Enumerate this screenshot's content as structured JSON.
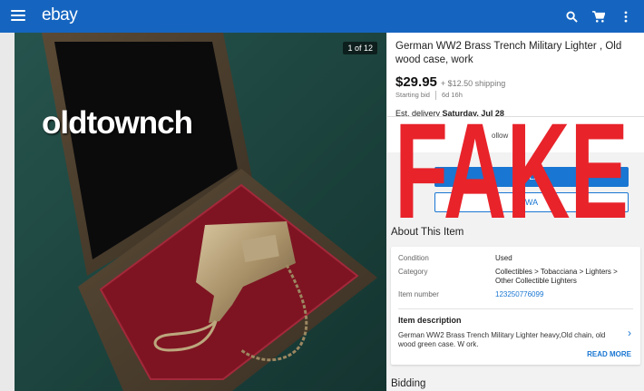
{
  "header": {
    "logo": "ebay",
    "menu_icon": "hamburger-menu-icon",
    "search_icon": "search-icon",
    "cart_icon": "cart-icon",
    "more_icon": "more-vert-icon",
    "brand_color": "#1565c0"
  },
  "gallery": {
    "counter": "1 of 12",
    "watermark": "oldtownch"
  },
  "listing": {
    "title": "German WW2 Brass Trench Military Lighter , Old wood case, work",
    "price": "$29.95",
    "shipping": "+ $12.50 shipping",
    "starting_bid_label": "Starting bid",
    "time_left": "6d 16h",
    "delivery_label": "Est. delivery",
    "delivery_date": "Saturday, Jul 28",
    "follow_label": "ollow",
    "bid_button": "PLA",
    "watch_button": "WA"
  },
  "overlay": {
    "text": "FAKE",
    "color": "#e8232a"
  },
  "about": {
    "heading": "About This Item",
    "specs": [
      {
        "key": "Condition",
        "value": "Used"
      },
      {
        "key": "Category",
        "value": "Collectibles > Tobacciana > Lighters > Other Collectible Lighters"
      },
      {
        "key": "Item number",
        "value": "123250776099"
      }
    ],
    "description_heading": "Item description",
    "description": "German WW2 Brass Trench Military Lighter heavy,Old chain, old wood green case. W ork.",
    "read_more": "READ MORE"
  },
  "bidding": {
    "heading": "Bidding"
  }
}
